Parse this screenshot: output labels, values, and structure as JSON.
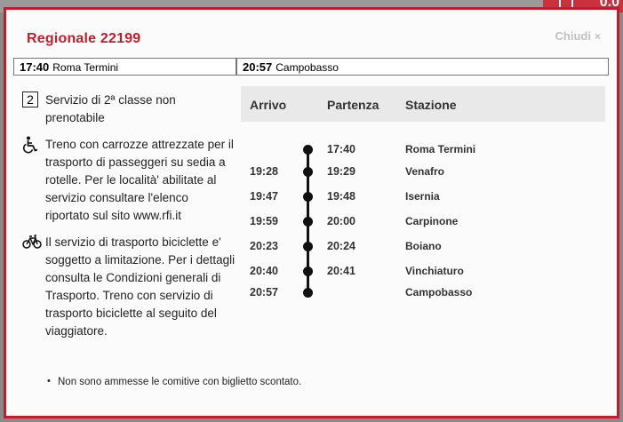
{
  "background": {
    "corner_text": "0.0"
  },
  "modal": {
    "title": "Regionale  22199",
    "close_label": "Chiudi",
    "close_glyph": "×"
  },
  "route": {
    "departure_time": "17:40",
    "departure_station": "Roma Termini",
    "arrival_time": "20:57",
    "arrival_station": "Campobasso"
  },
  "info": {
    "class_badge": "2",
    "class_text": "Servizio di 2ª classe non prenotabile",
    "wheelchair_text": "Treno con carrozze attrezzate per il trasporto di passeggeri su sedia a rotelle. Per le località' abilitate al servizio consultare l'elenco riportato sul sito www.rfi.it",
    "bicycle_text": "Il servizio di trasporto biciclette e' soggetto a limitazione. Per i dettagli consulta le Condizioni generali di Trasporto. Treno con servizio di trasporto biciclette al seguito del viaggiatore."
  },
  "notes": [
    "Non sono ammesse le comitive con biglietto scontato."
  ],
  "schedule": {
    "headers": {
      "arrival": "Arrivo",
      "departure": "Partenza",
      "station": "Stazione"
    },
    "stops": [
      {
        "arrival": "",
        "departure": "17:40",
        "station": "Roma Termini"
      },
      {
        "arrival": "19:28",
        "departure": "19:29",
        "station": "Venafro"
      },
      {
        "arrival": "19:47",
        "departure": "19:48",
        "station": "Isernia"
      },
      {
        "arrival": "19:59",
        "departure": "20:00",
        "station": "Carpinone"
      },
      {
        "arrival": "20:23",
        "departure": "20:24",
        "station": "Boiano"
      },
      {
        "arrival": "20:40",
        "departure": "20:41",
        "station": "Vinchiaturo"
      },
      {
        "arrival": "20:57",
        "departure": "",
        "station": "Campobasso"
      }
    ]
  },
  "colors": {
    "accent": "#c21d2b",
    "timeline": "#111111"
  }
}
